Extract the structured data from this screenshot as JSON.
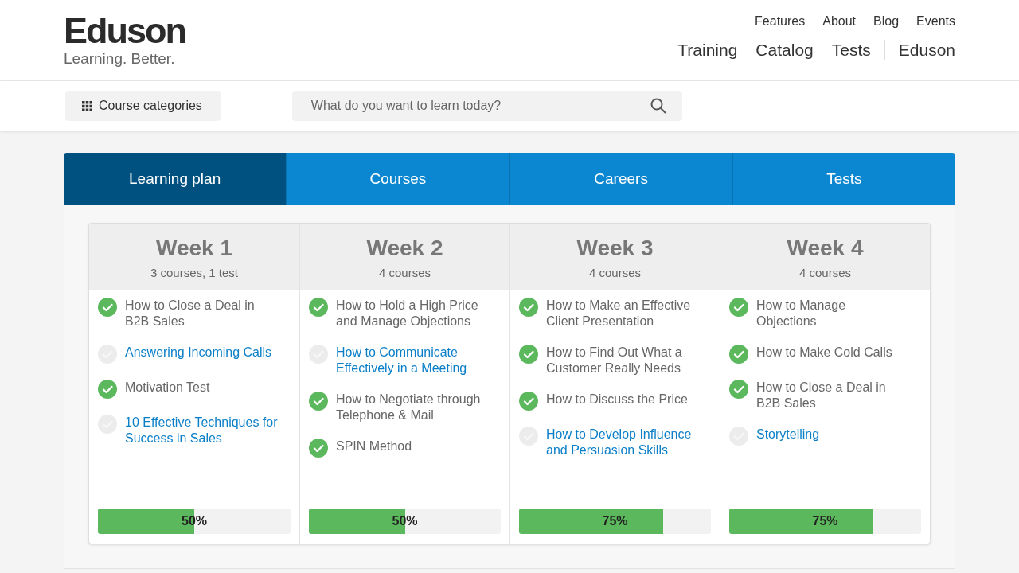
{
  "brand": {
    "name": "Eduson",
    "tagline": "Learning. Better."
  },
  "top_links": [
    "Features",
    "About",
    "Blog",
    "Events"
  ],
  "main_nav": [
    "Training",
    "Catalog",
    "Tests"
  ],
  "account_link": "Eduson",
  "categories_button": "Course categories",
  "search": {
    "placeholder": "What do you want to learn today?"
  },
  "tabs": [
    {
      "label": "Learning plan",
      "selected": true
    },
    {
      "label": "Courses",
      "selected": false
    },
    {
      "label": "Careers",
      "selected": false
    },
    {
      "label": "Tests",
      "selected": false
    }
  ],
  "weeks": [
    {
      "title": "Week 1",
      "summary": "3 courses, 1 test",
      "items": [
        {
          "title": "How to Close a Deal in B2B Sales",
          "completed": true
        },
        {
          "title": "Answering Incoming Calls",
          "completed": false
        },
        {
          "title": "Motivation Test",
          "completed": true
        },
        {
          "title": "10 Effective Techniques for Success in Sales",
          "completed": false
        }
      ],
      "progress": {
        "level": 0.5,
        "reading": "50%"
      }
    },
    {
      "title": "Week 2",
      "summary": "4 courses",
      "items": [
        {
          "title": "How to Hold a High Price and Manage Objections",
          "completed": true
        },
        {
          "title": "How to Communicate Effectively in a Meeting",
          "completed": false
        },
        {
          "title": "How to Negotiate through Telephone & Mail",
          "completed": true
        },
        {
          "title": "SPIN Method",
          "completed": true
        }
      ],
      "progress": {
        "level": 0.5,
        "reading": "50%"
      }
    },
    {
      "title": "Week 3",
      "summary": "4 courses",
      "items": [
        {
          "title": "How to Make an Effective Client Presentation",
          "completed": true
        },
        {
          "title": "How to Find Out What a Customer Really Needs",
          "completed": true
        },
        {
          "title": "How to Discuss the Price",
          "completed": true
        },
        {
          "title": "How to Develop Influence and Persuasion Skills",
          "completed": false
        }
      ],
      "progress": {
        "level": 0.75,
        "reading": "75%"
      }
    },
    {
      "title": "Week 4",
      "summary": "4 courses",
      "items": [
        {
          "title": "How to Manage Objections",
          "completed": true
        },
        {
          "title": "How to Make Cold Calls",
          "completed": true
        },
        {
          "title": "How to Close a Deal in B2B Sales",
          "completed": true
        },
        {
          "title": "Storytelling",
          "completed": false
        }
      ],
      "progress": {
        "level": 0.75,
        "reading": "75%"
      }
    }
  ]
}
